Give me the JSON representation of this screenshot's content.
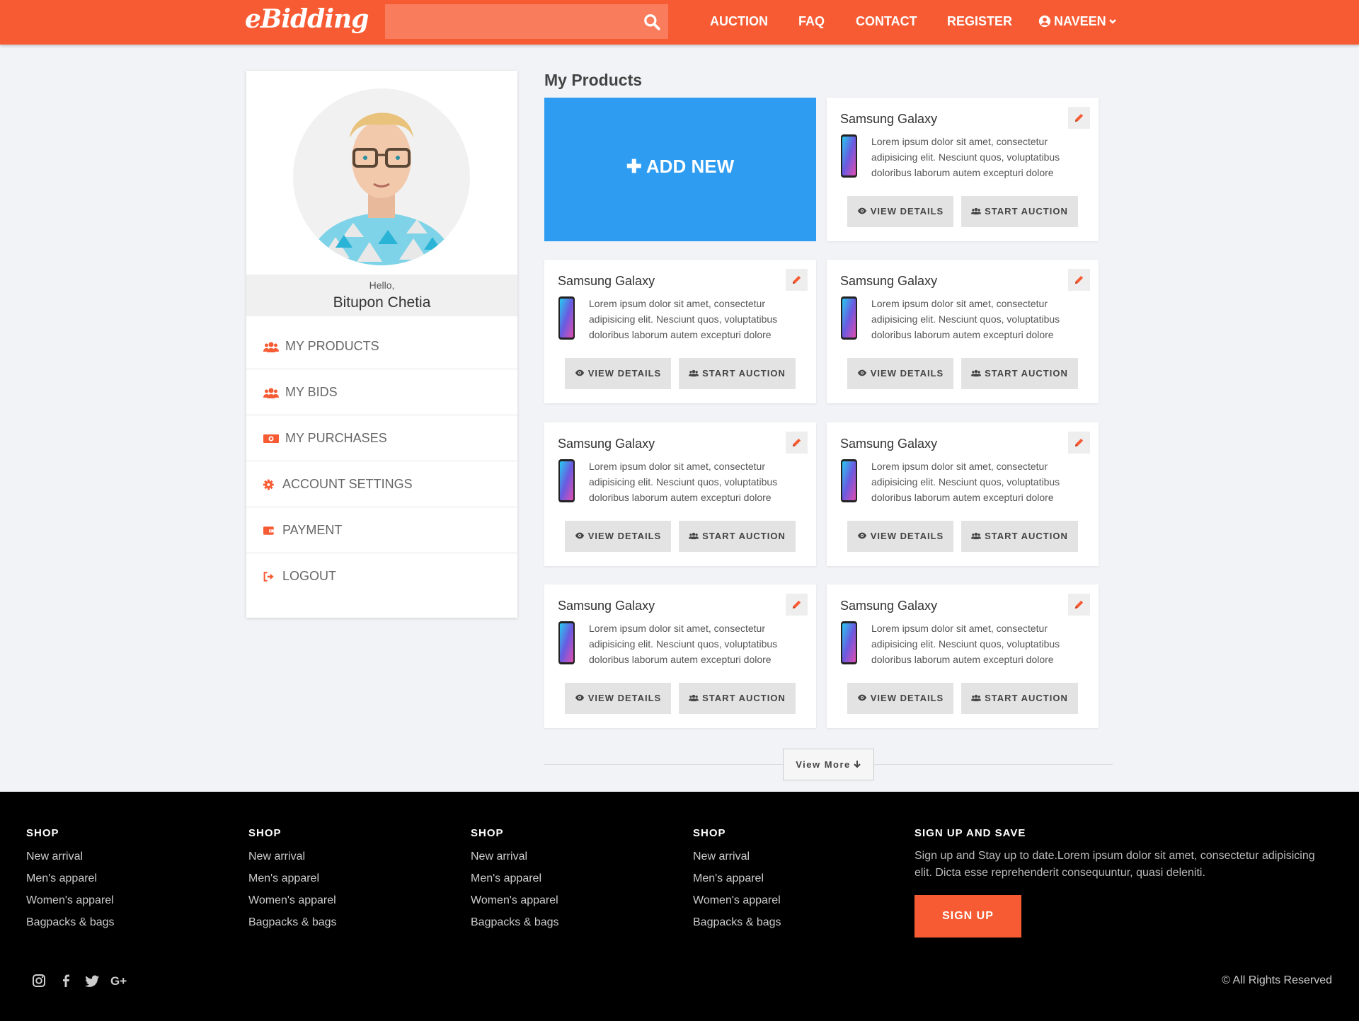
{
  "header": {
    "logo": "eBidding",
    "search_placeholder": "",
    "nav": [
      "AUCTION",
      "FAQ",
      "CONTACT",
      "REGISTER"
    ],
    "user": "NAVEEN",
    "brand_color": "#f75b33"
  },
  "sidebar": {
    "greeting": "Hello,",
    "user_name": "Bitupon Chetia",
    "menu": [
      {
        "label": "MY PRODUCTS",
        "icon": "users-icon"
      },
      {
        "label": "MY BIDS",
        "icon": "users-icon"
      },
      {
        "label": "MY PURCHASES",
        "icon": "money-icon"
      },
      {
        "label": "ACCOUNT SETTINGS",
        "icon": "gear-icon"
      },
      {
        "label": "PAYMENT",
        "icon": "wallet-icon"
      },
      {
        "label": "LOGOUT",
        "icon": "logout-icon"
      }
    ]
  },
  "main": {
    "title": "My Products",
    "add_new_label": "ADD NEW",
    "products": [
      {
        "title": "Samsung Galaxy",
        "desc": "Lorem ipsum dolor sit amet, consectetur adipisicing elit. Nesciunt quos, voluptatibus doloribus laborum autem excepturi dolore",
        "view": "VIEW DETAILS",
        "auction": "START AUCTION"
      },
      {
        "title": "Samsung Galaxy",
        "desc": "Lorem ipsum dolor sit amet, consectetur adipisicing elit. Nesciunt quos, voluptatibus doloribus laborum autem excepturi dolore",
        "view": "VIEW DETAILS",
        "auction": "START AUCTION"
      },
      {
        "title": "Samsung Galaxy",
        "desc": "Lorem ipsum dolor sit amet, consectetur adipisicing elit. Nesciunt quos, voluptatibus doloribus laborum autem excepturi dolore",
        "view": "VIEW DETAILS",
        "auction": "START AUCTION"
      },
      {
        "title": "Samsung Galaxy",
        "desc": "Lorem ipsum dolor sit amet, consectetur adipisicing elit. Nesciunt quos, voluptatibus doloribus laborum autem excepturi dolore",
        "view": "VIEW DETAILS",
        "auction": "START AUCTION"
      },
      {
        "title": "Samsung Galaxy",
        "desc": "Lorem ipsum dolor sit amet, consectetur adipisicing elit. Nesciunt quos, voluptatibus doloribus laborum autem excepturi dolore",
        "view": "VIEW DETAILS",
        "auction": "START AUCTION"
      },
      {
        "title": "Samsung Galaxy",
        "desc": "Lorem ipsum dolor sit amet, consectetur adipisicing elit. Nesciunt quos, voluptatibus doloribus laborum autem excepturi dolore",
        "view": "VIEW DETAILS",
        "auction": "START AUCTION"
      },
      {
        "title": "Samsung Galaxy",
        "desc": "Lorem ipsum dolor sit amet, consectetur adipisicing elit. Nesciunt quos, voluptatibus doloribus laborum autem excepturi dolore",
        "view": "VIEW DETAILS",
        "auction": "START AUCTION"
      }
    ],
    "view_more": "View More"
  },
  "footer": {
    "columns": [
      {
        "heading": "SHOP",
        "links": [
          "New arrival",
          "Men's apparel",
          "Women's apparel",
          "Bagpacks & bags"
        ]
      },
      {
        "heading": "SHOP",
        "links": [
          "New arrival",
          "Men's apparel",
          "Women's apparel",
          "Bagpacks & bags"
        ]
      },
      {
        "heading": "SHOP",
        "links": [
          "New arrival",
          "Men's apparel",
          "Women's apparel",
          "Bagpacks & bags"
        ]
      },
      {
        "heading": "SHOP",
        "links": [
          "New arrival",
          "Men's apparel",
          "Women's apparel",
          "Bagpacks & bags"
        ]
      }
    ],
    "signup_heading": "SIGN UP AND SAVE",
    "signup_text": "Sign up and Stay up to date.Lorem ipsum dolor sit amet, consectetur adipisicing elit. Dicta esse reprehenderit consequuntur, quasi deleniti.",
    "signup_button": "SIGN UP",
    "social": [
      "instagram-icon",
      "facebook-icon",
      "twitter-icon",
      "google-plus-icon"
    ],
    "copyright": "© All Rights Reserved"
  }
}
